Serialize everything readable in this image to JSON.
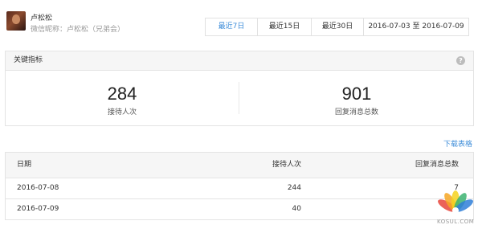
{
  "user": {
    "name": "卢松松",
    "wechat_nickname": "微信昵称：卢松松（兄弟会）"
  },
  "date_filter": {
    "tabs": [
      "最近7日",
      "最近15日",
      "最近30日"
    ],
    "active_index": 0,
    "range": "2016-07-03 至 2016-07-09"
  },
  "key_metrics": {
    "title": "关键指标",
    "help_icon": "?",
    "items": [
      {
        "value": "284",
        "label": "接待人次"
      },
      {
        "value": "901",
        "label": "回复消息总数"
      }
    ]
  },
  "download_label": "下载表格",
  "table": {
    "headers": [
      "日期",
      "接待人次",
      "回复消息总数"
    ],
    "rows": [
      [
        "2016-07-08",
        "244",
        "7"
      ],
      [
        "2016-07-09",
        "40",
        ""
      ]
    ]
  },
  "watermark": "KOSUL.COM",
  "colors": {
    "accent": "#3f8ed9",
    "header_bg": "#f6f6f6",
    "border": "#e4e4e4"
  }
}
